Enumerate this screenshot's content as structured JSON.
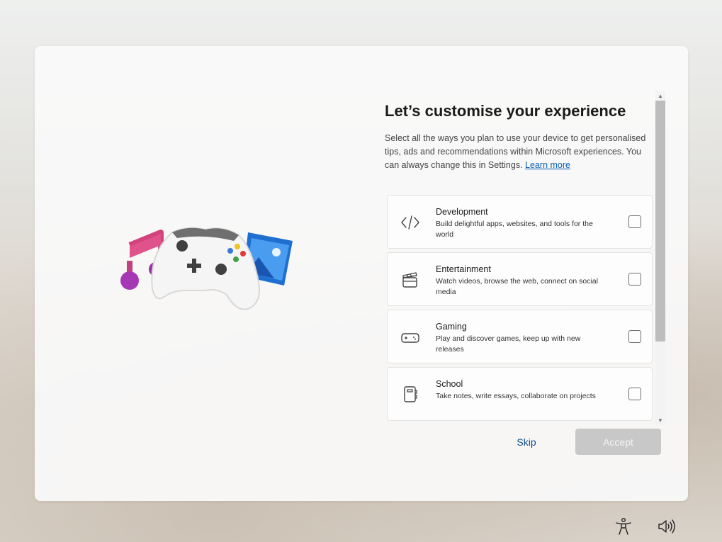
{
  "page": {
    "title": "Let’s customise your experience",
    "description": "Select all the ways you plan to use your device to get personalised tips, ads and recommendations within Microsoft experiences. You can always change this in Settings.",
    "learn_more": "Learn more"
  },
  "options": [
    {
      "icon": "code-icon",
      "title": "Development",
      "description": "Build delightful apps, websites, and tools for the world",
      "checked": false
    },
    {
      "icon": "clapperboard-icon",
      "title": "Entertainment",
      "description": "Watch videos, browse the web, connect on social media",
      "checked": false
    },
    {
      "icon": "gamepad-icon",
      "title": "Gaming",
      "description": "Play and discover games, keep up with new releases",
      "checked": false
    },
    {
      "icon": "notebook-icon",
      "title": "School",
      "description": "Take notes, write essays, collaborate on projects",
      "checked": false
    }
  ],
  "actions": {
    "skip": "Skip",
    "accept": "Accept"
  },
  "system_tray": {
    "accessibility_icon": "accessibility-icon",
    "volume_icon": "volume-icon"
  },
  "colors": {
    "accent": "#0a5fb4",
    "accept_disabled": "#c8c8c8"
  }
}
